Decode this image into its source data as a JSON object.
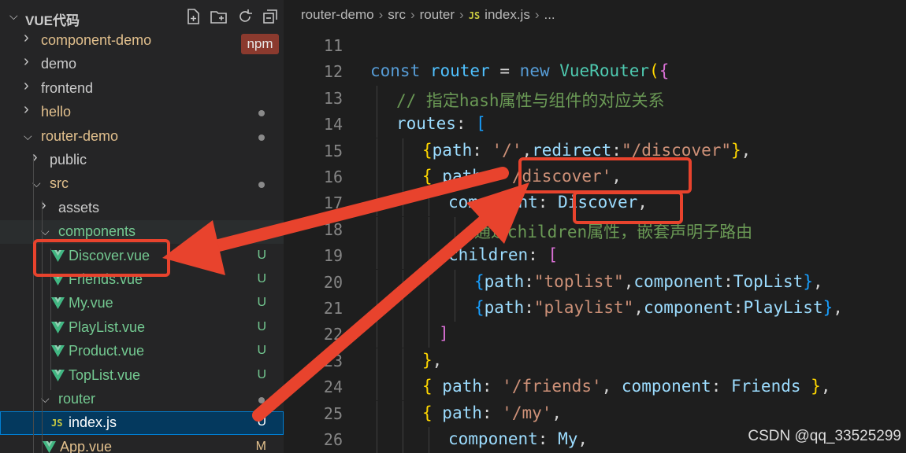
{
  "explorer": {
    "title": "VUE代码",
    "actions": [
      "new-file-icon",
      "new-folder-icon",
      "refresh-icon",
      "collapse-all-icon"
    ],
    "npm_badge": "npm",
    "items": [
      {
        "label": "component-demo",
        "type": "folder",
        "state": "collapsed",
        "depth": 0,
        "color": "#e2c08d",
        "status": ""
      },
      {
        "label": "demo",
        "type": "folder",
        "state": "collapsed",
        "depth": 0,
        "color": "#cccccc",
        "status": ""
      },
      {
        "label": "frontend",
        "type": "folder",
        "state": "collapsed",
        "depth": 0,
        "color": "#cccccc",
        "status": ""
      },
      {
        "label": "hello",
        "type": "folder",
        "state": "collapsed",
        "depth": 0,
        "color": "#e2c08d",
        "status": "dot"
      },
      {
        "label": "router-demo",
        "type": "folder",
        "state": "expanded",
        "depth": 0,
        "color": "#e2c08d",
        "status": "dot"
      },
      {
        "label": "public",
        "type": "folder",
        "state": "collapsed",
        "depth": 1,
        "color": "#cccccc",
        "status": ""
      },
      {
        "label": "src",
        "type": "folder",
        "state": "expanded",
        "depth": 1,
        "color": "#e2c08d",
        "status": "dot"
      },
      {
        "label": "assets",
        "type": "folder",
        "state": "collapsed",
        "depth": 2,
        "color": "#cccccc",
        "status": ""
      },
      {
        "label": "components",
        "type": "folder",
        "state": "expanded",
        "depth": 2,
        "color": "#73c991",
        "status": "dot"
      },
      {
        "label": "Discover.vue",
        "type": "vue",
        "depth": 3,
        "color": "#73c991",
        "status": "U"
      },
      {
        "label": "Friends.vue",
        "type": "vue",
        "depth": 3,
        "color": "#73c991",
        "status": "U"
      },
      {
        "label": "My.vue",
        "type": "vue",
        "depth": 3,
        "color": "#73c991",
        "status": "U"
      },
      {
        "label": "PlayList.vue",
        "type": "vue",
        "depth": 3,
        "color": "#73c991",
        "status": "U"
      },
      {
        "label": "Product.vue",
        "type": "vue",
        "depth": 3,
        "color": "#73c991",
        "status": "U"
      },
      {
        "label": "TopList.vue",
        "type": "vue",
        "depth": 3,
        "color": "#73c991",
        "status": "U"
      },
      {
        "label": "router",
        "type": "folder",
        "state": "expanded",
        "depth": 2,
        "color": "#73c991",
        "status": "dot"
      },
      {
        "label": "index.js",
        "type": "js",
        "depth": 3,
        "color": "#ffffff",
        "status": "U",
        "selected": true
      },
      {
        "label": "App.vue",
        "type": "vue",
        "depth": 2,
        "color": "#e2c08d",
        "status": "M"
      }
    ]
  },
  "breadcrumb": {
    "parts": [
      "router-demo",
      "src",
      "router"
    ],
    "file_icon": "JS",
    "file": "index.js",
    "tail": "..."
  },
  "code": {
    "lines": [
      {
        "n": "11",
        "indent": 0,
        "tokens": []
      },
      {
        "n": "12",
        "indent": 0,
        "tokens": [
          [
            "k",
            "const "
          ],
          [
            "c",
            "router "
          ],
          [
            "p",
            "= "
          ],
          [
            "k",
            "new "
          ],
          [
            "t",
            "VueRouter"
          ],
          [
            "b1",
            "("
          ],
          [
            "b2",
            "{"
          ]
        ]
      },
      {
        "n": "13",
        "indent": 1,
        "tokens": [
          [
            "cm",
            "// 指定hash属性与组件的对应关系"
          ]
        ]
      },
      {
        "n": "14",
        "indent": 1,
        "tokens": [
          [
            "v",
            "routes"
          ],
          [
            "p",
            ": "
          ],
          [
            "b3",
            "["
          ]
        ]
      },
      {
        "n": "15",
        "indent": 2,
        "tokens": [
          [
            "b1",
            "{"
          ],
          [
            "v",
            "path"
          ],
          [
            "p",
            ": "
          ],
          [
            "s",
            "'/'"
          ],
          [
            "p",
            ","
          ],
          [
            "v",
            "redirect"
          ],
          [
            "p",
            ":"
          ],
          [
            "s",
            "\"/discover\""
          ],
          [
            "b1",
            "}"
          ],
          [
            "p",
            ","
          ]
        ]
      },
      {
        "n": "16",
        "indent": 2,
        "tokens": [
          [
            "b1",
            "{ "
          ],
          [
            "v",
            "path"
          ],
          [
            "p",
            ": "
          ],
          [
            "s",
            "'/discover'"
          ],
          [
            "p",
            ","
          ]
        ]
      },
      {
        "n": "17",
        "indent": 3,
        "tokens": [
          [
            "v",
            "component"
          ],
          [
            "p",
            ": "
          ],
          [
            "v",
            "Discover"
          ],
          [
            "p",
            ","
          ]
        ]
      },
      {
        "n": "18",
        "indent": 4,
        "tokens": [
          [
            "cm",
            "通过children属性，嵌套声明子路由"
          ]
        ]
      },
      {
        "n": "19",
        "indent": 3,
        "tokens": [
          [
            "v",
            "children"
          ],
          [
            "p",
            ": "
          ],
          [
            "b2",
            "["
          ]
        ]
      },
      {
        "n": "20",
        "indent": 4,
        "tokens": [
          [
            "b3",
            "{"
          ],
          [
            "v",
            "path"
          ],
          [
            "p",
            ":"
          ],
          [
            "s",
            "\"toplist\""
          ],
          [
            "p",
            ","
          ],
          [
            "v",
            "component"
          ],
          [
            "p",
            ":"
          ],
          [
            "v",
            "TopList"
          ],
          [
            "b3",
            "}"
          ],
          [
            "p",
            ","
          ]
        ]
      },
      {
        "n": "21",
        "indent": 4,
        "tokens": [
          [
            "b3",
            "{"
          ],
          [
            "v",
            "path"
          ],
          [
            "p",
            ":"
          ],
          [
            "s",
            "\"playlist\""
          ],
          [
            "p",
            ","
          ],
          [
            "v",
            "component"
          ],
          [
            "p",
            ":"
          ],
          [
            "v",
            "PlayList"
          ],
          [
            "b3",
            "}"
          ],
          [
            "p",
            ","
          ]
        ]
      },
      {
        "n": "22",
        "indent": 3,
        "tokens": [
          [
            "b2",
            "]"
          ]
        ],
        "offset": -12
      },
      {
        "n": "23",
        "indent": 2,
        "tokens": [
          [
            "b1",
            "}"
          ],
          [
            "p",
            ","
          ]
        ]
      },
      {
        "n": "24",
        "indent": 2,
        "tokens": [
          [
            "b1",
            "{ "
          ],
          [
            "v",
            "path"
          ],
          [
            "p",
            ": "
          ],
          [
            "s",
            "'/friends'"
          ],
          [
            "p",
            ", "
          ],
          [
            "v",
            "component"
          ],
          [
            "p",
            ": "
          ],
          [
            "v",
            "Friends "
          ],
          [
            "b1",
            "}"
          ],
          [
            "p",
            ","
          ]
        ]
      },
      {
        "n": "25",
        "indent": 2,
        "tokens": [
          [
            "b1",
            "{ "
          ],
          [
            "v",
            "path"
          ],
          [
            "p",
            ": "
          ],
          [
            "s",
            "'/my'"
          ],
          [
            "p",
            ","
          ]
        ]
      },
      {
        "n": "26",
        "indent": 3,
        "tokens": [
          [
            "v",
            "component"
          ],
          [
            "p",
            ": "
          ],
          [
            "v",
            "My"
          ],
          [
            "p",
            ","
          ]
        ]
      }
    ]
  },
  "annotation_color": "#e8432d",
  "watermark": "CSDN @qq_33525299"
}
